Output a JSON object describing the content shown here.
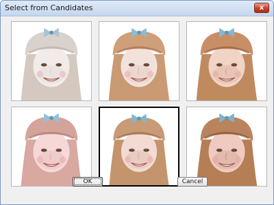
{
  "window": {
    "title": "Select from Candidates",
    "close_label": "x"
  },
  "candidates": [
    {
      "name": "candidate-1",
      "style": "washed",
      "selected": false
    },
    {
      "name": "candidate-2",
      "style": "light",
      "selected": false
    },
    {
      "name": "candidate-3",
      "style": "warm",
      "selected": false
    },
    {
      "name": "candidate-4",
      "style": "pink",
      "selected": false
    },
    {
      "name": "candidate-5",
      "style": "medium",
      "selected": true
    },
    {
      "name": "candidate-6",
      "style": "dark",
      "selected": false
    }
  ],
  "buttons": {
    "ok_label": "OK",
    "cancel_label": "Cancel"
  },
  "colors": {
    "title_bar": "#c4d6ee",
    "close_button": "#c5422b",
    "dialog_background": "#f0f0f0",
    "selected_border": "#000000"
  }
}
